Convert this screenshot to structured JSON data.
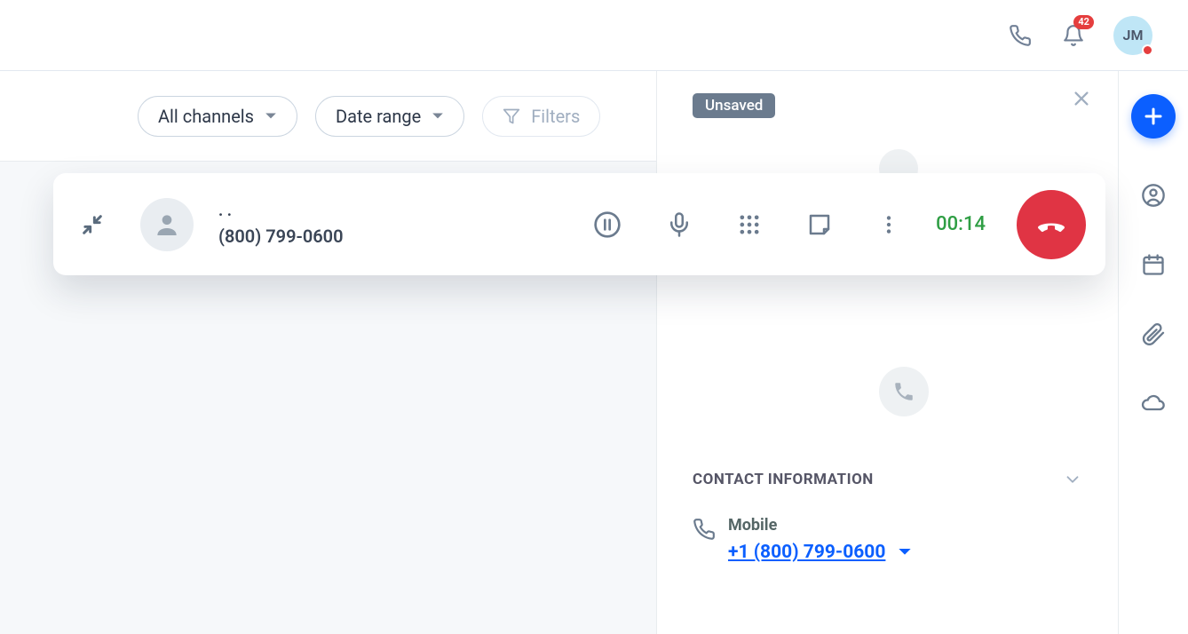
{
  "header": {
    "notification_count": "42",
    "avatar_initials": "JM"
  },
  "filters": {
    "channels_label": "All channels",
    "date_range_label": "Date range",
    "filters_label": "Filters"
  },
  "call_bar": {
    "caller_name": ". .",
    "caller_phone": "(800) 799-0600",
    "timer": "00:14"
  },
  "contact_panel": {
    "status_tag": "Unsaved",
    "section_title": "CONTACT INFORMATION",
    "mobile_label": "Mobile",
    "mobile_value": "+1 (800) 799-0600"
  }
}
